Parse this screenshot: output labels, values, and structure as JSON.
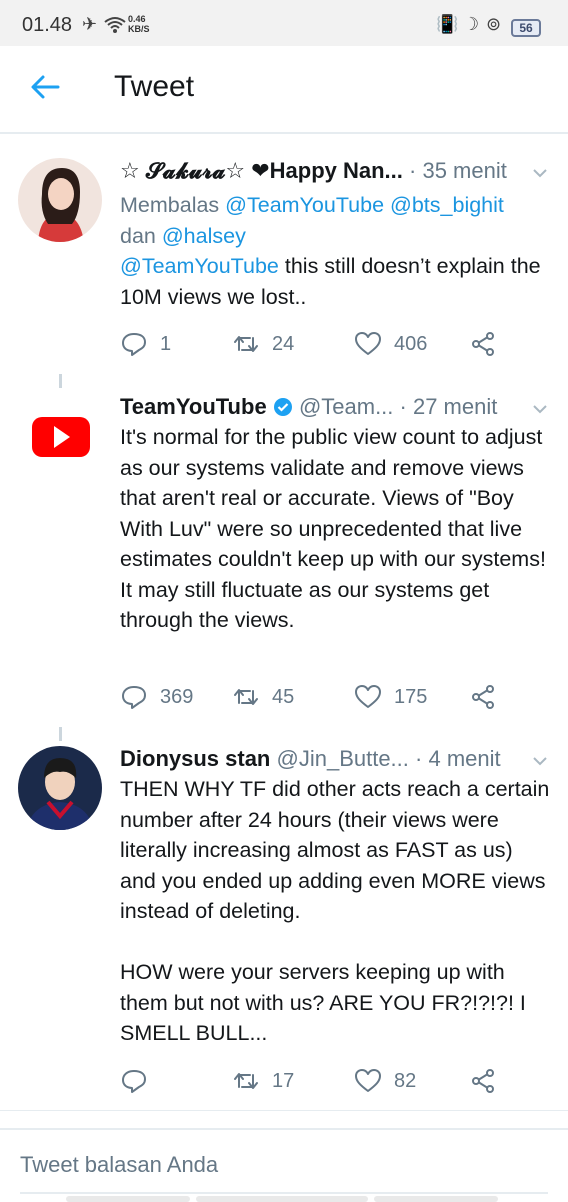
{
  "status": {
    "time": "01.48",
    "speed_value": "0.46",
    "speed_unit": "KB/S",
    "battery": "56"
  },
  "header": {
    "title": "Tweet"
  },
  "tweets": [
    {
      "name": "☆ 𝓢𝓪𝓴𝓾𝓻𝓪☆ ❤Happy Nan...",
      "handle": "",
      "time": "· 35 menit",
      "reply_prefix": "Membalas ",
      "reply_users": "@TeamYouTube @bts_bighit",
      "reply_and": "dan ",
      "reply_last": "@halsey",
      "mention": "@TeamYouTube",
      "text": " this still doesn’t explain the 10M views we lost..",
      "replies": "1",
      "retweets": "24",
      "likes": "406"
    },
    {
      "name": "TeamYouTube",
      "handle": "@Team...",
      "time": "· 27 menit",
      "text": "It's normal for the public view count to adjust as our systems validate and remove views that aren't real or accurate. Views of \"Boy With Luv\" were so unprecedented that live estimates couldn't keep up with our systems! It may still fluctuate as our systems get through the views.",
      "replies": "369",
      "retweets": "45",
      "likes": "175"
    },
    {
      "name": "Dionysus stan",
      "handle": "@Jin_Butte...",
      "time": "· 4 menit",
      "text": "THEN WHY TF did other acts reach a certain number after 24 hours (their views were literally increasing almost as FAST as us) and you ended up adding even MORE views instead of deleting.\n\nHOW were your servers keeping up with them but not with us? ARE YOU FR?!?!?! I SMELL BULL...",
      "replies": "",
      "retweets": "17",
      "likes": "82"
    }
  ],
  "reply_box": {
    "placeholder": "Tweet balasan Anda"
  },
  "colors": {
    "link": "#1b95e0",
    "muted": "#657786",
    "youtube_red": "#ff0000",
    "verified": "#1da1f2"
  }
}
